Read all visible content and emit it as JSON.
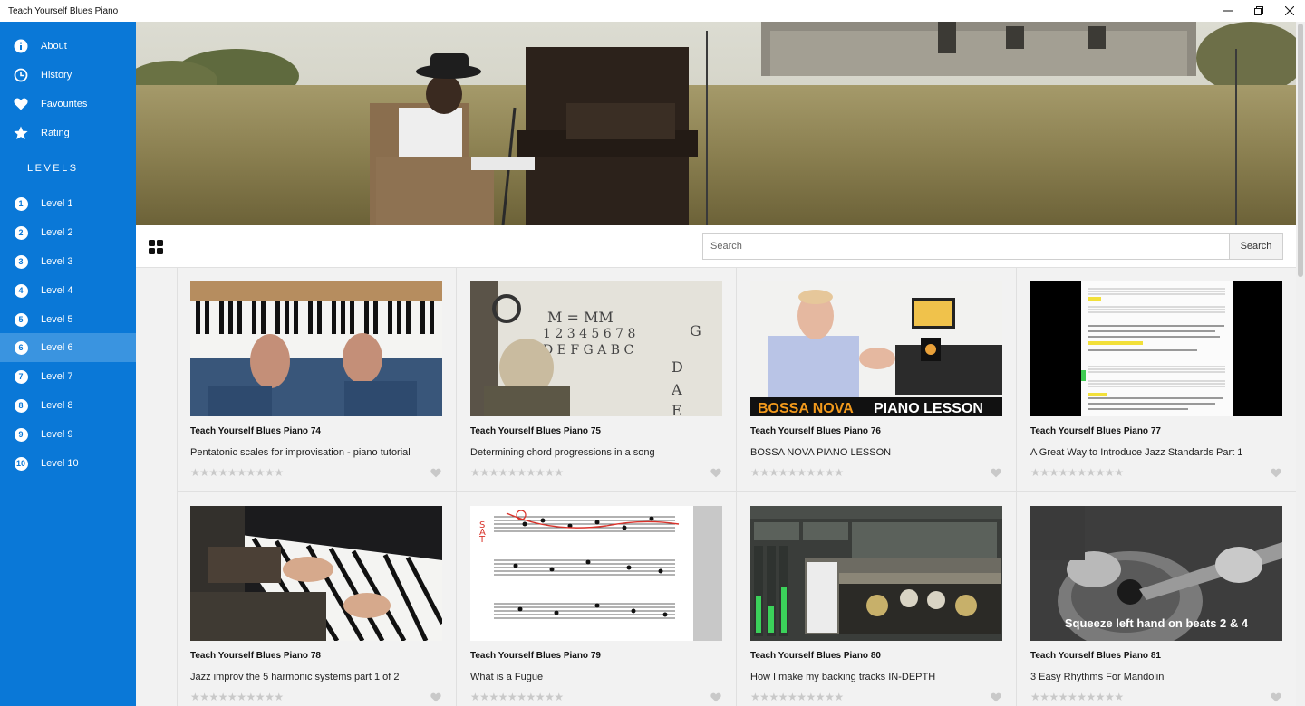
{
  "window": {
    "title": "Teach Yourself Blues Piano",
    "controls": [
      "minimize",
      "restore",
      "close"
    ]
  },
  "sidebar": {
    "top_items": [
      {
        "label": "About",
        "icon": "info-icon"
      },
      {
        "label": "History",
        "icon": "clock-icon"
      },
      {
        "label": "Favourites",
        "icon": "heart-icon"
      },
      {
        "label": "Rating",
        "icon": "star-icon"
      }
    ],
    "levels_heading": "LEVELS",
    "levels": [
      {
        "num": "1",
        "label": "Level 1"
      },
      {
        "num": "2",
        "label": "Level 2"
      },
      {
        "num": "3",
        "label": "Level 3"
      },
      {
        "num": "4",
        "label": "Level 4"
      },
      {
        "num": "5",
        "label": "Level 5"
      },
      {
        "num": "6",
        "label": "Level 6"
      },
      {
        "num": "7",
        "label": "Level 7"
      },
      {
        "num": "8",
        "label": "Level 8"
      },
      {
        "num": "9",
        "label": "Level 9"
      },
      {
        "num": "10",
        "label": "Level 10"
      }
    ],
    "active_level": "Level 6"
  },
  "toolbar": {
    "search_placeholder": "Search",
    "search_button": "Search"
  },
  "videos": [
    {
      "title": "Teach Yourself Blues Piano 74",
      "subtitle": "Pentatonic scales for improvisation - piano tutorial",
      "rating": 0
    },
    {
      "title": "Teach Yourself Blues Piano 75",
      "subtitle": "Determining chord progressions in a song",
      "rating": 0
    },
    {
      "title": "Teach Yourself Blues Piano 76",
      "subtitle": "BOSSA NOVA PIANO LESSON",
      "rating": 0,
      "thumb_text": [
        "BOSSA NOVA",
        "PIANO LESSON"
      ]
    },
    {
      "title": "Teach Yourself Blues Piano 77",
      "subtitle": "A Great Way to Introduce Jazz Standards Part 1",
      "rating": 0
    },
    {
      "title": "Teach Yourself Blues Piano 78",
      "subtitle": "Jazz improv the 5 harmonic systems part 1 of 2",
      "rating": 0
    },
    {
      "title": "Teach Yourself Blues Piano 79",
      "subtitle": "What is a Fugue",
      "rating": 0,
      "thumb_text": [
        "S",
        "A",
        "T"
      ]
    },
    {
      "title": "Teach Yourself Blues Piano 80",
      "subtitle": "How I make my backing tracks IN-DEPTH",
      "rating": 0
    },
    {
      "title": "Teach Yourself Blues Piano 81",
      "subtitle": "3 Easy Rhythms For Mandolin",
      "rating": 0,
      "thumb_text": [
        "Squeeze left hand on beats 2 & 4"
      ]
    }
  ],
  "stars_text": "★★★★★★★★★★",
  "colors": {
    "sidebar": "#0a78d7",
    "sidebar_active": "#3a94e0",
    "bossa_orange": "#f39a1c",
    "star_empty": "#c9c9c9"
  }
}
